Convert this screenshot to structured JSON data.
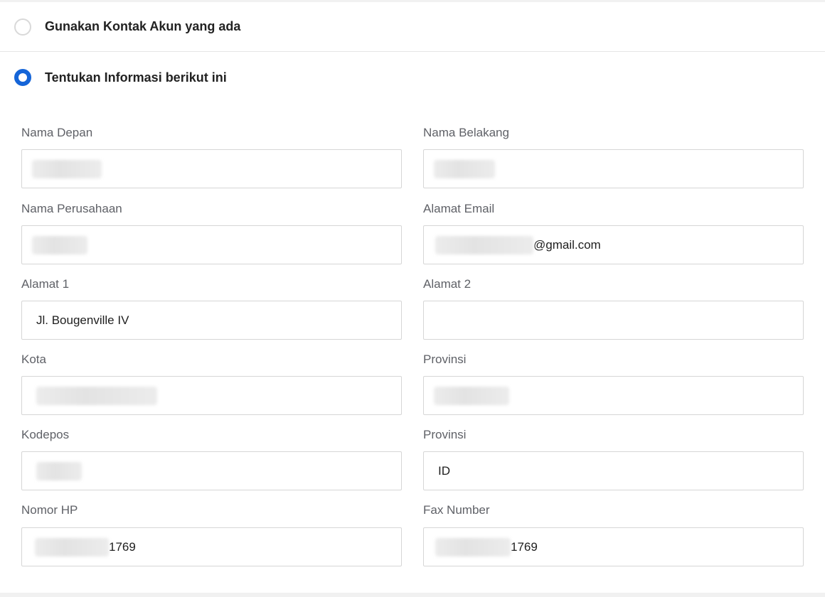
{
  "options": {
    "use_account": {
      "label": "Gunakan Kontak Akun yang ada",
      "selected": false
    },
    "specify_info": {
      "label": "Tentukan Informasi berikut ini",
      "selected": true
    }
  },
  "colors": {
    "accent": "#1565d8",
    "label": "#5f6167",
    "border": "#d6d6d6"
  },
  "fields": {
    "first_name": {
      "label": "Nama Depan",
      "value": ""
    },
    "last_name": {
      "label": "Nama Belakang",
      "value": ""
    },
    "company": {
      "label": "Nama Perusahaan",
      "value": ""
    },
    "email": {
      "label": "Alamat Email",
      "value_suffix": "@gmail.com"
    },
    "address1": {
      "label": "Alamat 1",
      "value": "Jl. Bougenville IV"
    },
    "address2": {
      "label": "Alamat 2",
      "value": ""
    },
    "city": {
      "label": "Kota",
      "value": ""
    },
    "province": {
      "label": "Provinsi",
      "value": ""
    },
    "postcode": {
      "label": "Kodepos",
      "value": ""
    },
    "country": {
      "label": "Provinsi",
      "value": "ID"
    },
    "phone": {
      "label": "Nomor HP",
      "value_suffix": "1769"
    },
    "fax": {
      "label": "Fax Number",
      "value_suffix": "1769"
    }
  }
}
